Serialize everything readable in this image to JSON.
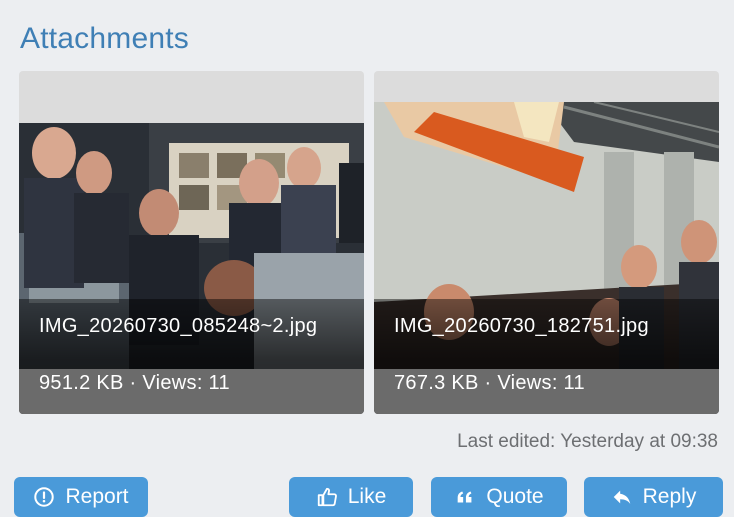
{
  "section": {
    "title": "Attachments"
  },
  "attachments": [
    {
      "name": "IMG_20260730_085248~2.jpg",
      "meta": "951.2 KB · Views: 11"
    },
    {
      "name": "IMG_20260730_182751.jpg",
      "meta": "767.3 KB · Views: 11"
    }
  ],
  "footer": {
    "last_edited": "Last edited: Yesterday at 09:38"
  },
  "actions": {
    "report_label": "Report",
    "like_label": "Like",
    "quote_label": "Quote",
    "reply_label": "Reply"
  },
  "colors": {
    "accent": "#4a9ad9",
    "title": "#3f7fb5",
    "background": "#eceef1"
  },
  "icons": [
    "alert-circle-icon",
    "thumbs-up-icon",
    "quote-icon",
    "reply-arrow-icon"
  ]
}
